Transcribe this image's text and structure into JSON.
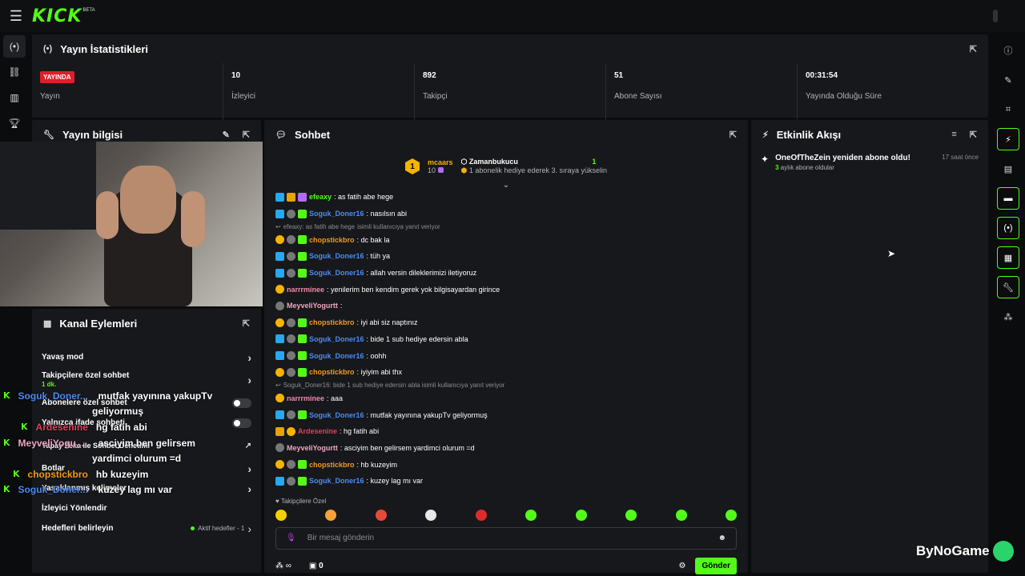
{
  "app": {
    "logo": "KICK",
    "logo_badge": "BETA"
  },
  "left_rail": {
    "items": [
      "broadcast-icon",
      "link-icon",
      "chart-icon",
      "trophy-icon"
    ]
  },
  "right_rail": {
    "items": [
      "info-icon",
      "pen-icon",
      "scan-icon",
      "bolt-icon",
      "notes-icon",
      "chat-icon",
      "broadcast-icon",
      "layout-icon",
      "wrench-icon",
      "dots-icon"
    ]
  },
  "stats": {
    "title": "Yayın İstatistikleri",
    "cells": [
      {
        "value": "YAYINDA",
        "label": "Yayın"
      },
      {
        "value": "10",
        "label": "İzleyici"
      },
      {
        "value": "892",
        "label": "Takipçi"
      },
      {
        "value": "51",
        "label": "Abone Sayısı"
      },
      {
        "value": "00:31:54",
        "label": "Yayında Olduğu Süre"
      }
    ]
  },
  "yayin_bilgisi": {
    "title": "Yayın bilgisi"
  },
  "kanal": {
    "title": "Kanal Eylemleri",
    "items": [
      {
        "label": "Yavaş mod"
      },
      {
        "label": "Takipçilere özel sohbet",
        "sub": "1 dk."
      },
      {
        "label": "Abonelere özel sohbet"
      },
      {
        "label": "Yalnızca ifade sohbeti"
      },
      {
        "label": "Yapay Zeka ile Sohbet Denetimi"
      },
      {
        "label": "Botlar"
      },
      {
        "label": "Yasaklanmış kelimeler"
      },
      {
        "label": "İzleyici Yönlendir"
      },
      {
        "label": "Hedefleri belirleyin",
        "aktif": "Aktif hedefler - 1"
      }
    ]
  },
  "overlay": [
    {
      "user": "Soguk_Doner...",
      "text": "mutfak yayınına yakupTv",
      "text2": "geliyormuş",
      "color": "#4b8bf5"
    },
    {
      "user": "Ardesenine",
      "text": "hg fatih abi",
      "color": "#e0405a"
    },
    {
      "user": "MeyveliYogu...",
      "text": "asciyim ben gelirsem",
      "text2": "yardimci olurum =d",
      "color": "#f0a6c0"
    },
    {
      "user": "chopstickbro",
      "text": "hb kuzeyim",
      "color": "#f39a1e"
    },
    {
      "user": "Soguk_Doner...",
      "text": "kuzey lag mı var",
      "color": "#4b8bf5"
    }
  ],
  "chat": {
    "title": "Sohbet",
    "pinned": {
      "rank": "1",
      "user": "mcaars",
      "count": "10",
      "gifter": "Zamanbukucu",
      "gift_count": "1",
      "message": "1 abonelik hediye ederek 3. sıraya yükselin"
    },
    "messages": [
      {
        "user": "efeaxy",
        "color": "#53fc18",
        "text": ": as fatih abe hege",
        "badges": [
          "sub",
          "crown",
          "purple"
        ]
      },
      {
        "user": "Soguk_Doner16",
        "color": "#4b8bf5",
        "text": ": nasılsın abi",
        "badges": [
          "sub",
          "shield",
          "gift"
        ]
      },
      {
        "reply": "efeaxy: as fatih abe hege",
        "reply2": "isimli kullanıcıya yanıt veriyor"
      },
      {
        "user": "chopstickbro",
        "color": "#f39a1e",
        "text": ": dc bak la",
        "badges": [
          "rank",
          "shield",
          "gift"
        ]
      },
      {
        "user": "Soguk_Doner16",
        "color": "#4b8bf5",
        "text": ": tüh ya",
        "badges": [
          "sub",
          "shield",
          "gift"
        ]
      },
      {
        "user": "Soguk_Doner16",
        "color": "#4b8bf5",
        "text": ": allah versin dileklerimizi iletiyoruz",
        "badges": [
          "sub",
          "shield",
          "gift"
        ]
      },
      {
        "user": "narrrminee",
        "color": "#f08aa8",
        "text": ": yenilerim ben kendim gerek yok bilgisayardan girince",
        "badges": [
          "rank"
        ]
      },
      {
        "user": "MeyveliYogurtt",
        "color": "#f0a6c0",
        "text": ":",
        "badges": [
          "shield"
        ]
      },
      {
        "user": "chopstickbro",
        "color": "#f39a1e",
        "text": ": iyi abi siz naptınız",
        "badges": [
          "rank",
          "shield",
          "gift"
        ]
      },
      {
        "user": "Soguk_Doner16",
        "color": "#4b8bf5",
        "text": ": bide 1 sub hediye edersin abla",
        "badges": [
          "sub",
          "shield",
          "gift"
        ]
      },
      {
        "user": "Soguk_Doner16",
        "color": "#4b8bf5",
        "text": ": oohh",
        "badges": [
          "sub",
          "shield",
          "gift"
        ]
      },
      {
        "user": "chopstickbro",
        "color": "#f39a1e",
        "text": ": iyiyim abi thx",
        "badges": [
          "rank",
          "shield",
          "gift"
        ]
      },
      {
        "reply": "Soguk_Doner16: bide 1 sub hediye edersin abla isimli kullanıcıya yanıt veriyor",
        "reply2": ""
      },
      {
        "user": "narrrminee",
        "color": "#f08aa8",
        "text": ": aaa",
        "badges": [
          "rank"
        ]
      },
      {
        "user": "Soguk_Doner16",
        "color": "#4b8bf5",
        "text": ": mutfak yayınına yakupTv geliyormuş",
        "badges": [
          "sub",
          "shield",
          "gift"
        ]
      },
      {
        "user": "Ardesenine",
        "color": "#e0405a",
        "text": ": hg fatih abi",
        "badges": [
          "crown",
          "rank"
        ]
      },
      {
        "user": "MeyveliYogurtt",
        "color": "#f0a6c0",
        "text": ": asciyim ben gelirsem yardimci olurum =d",
        "badges": [
          "shield"
        ]
      },
      {
        "user": "chopstickbro",
        "color": "#f39a1e",
        "text": ": hb kuzeyim",
        "badges": [
          "rank",
          "shield",
          "gift"
        ]
      },
      {
        "user": "Soguk_Doner16",
        "color": "#4b8bf5",
        "text": ": kuzey lag mı var",
        "badges": [
          "sub",
          "shield",
          "gift"
        ]
      }
    ],
    "emote_label": "Takipçilere Özel",
    "input_placeholder": "Bir mesaj gönderin",
    "points": "∞",
    "gift_count": "0",
    "send_label": "Gönder"
  },
  "activity": {
    "title": "Etkinlik Akışı",
    "items": [
      {
        "title": "OneOfTheZein yeniden abone oldu!",
        "time": "17 saat önce",
        "months": "3",
        "sub": "aylık abone oldular"
      }
    ]
  },
  "watermark": "ByNoGame"
}
